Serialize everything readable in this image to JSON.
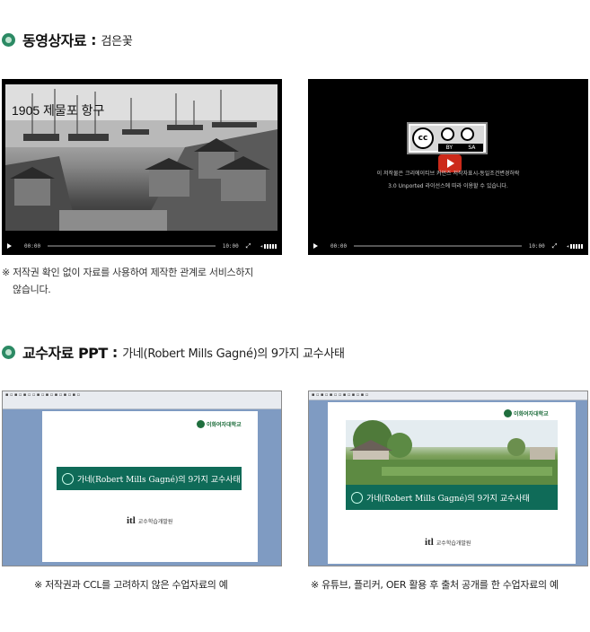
{
  "section1": {
    "title": "동영상자료",
    "colon": ":",
    "subtitle": "검은꽃"
  },
  "video1": {
    "caption": "1905 제물포 항구",
    "time_current": "00:00",
    "time_total": "10:00"
  },
  "video2": {
    "cc_by": "BY",
    "cc_sa": "SA",
    "license_line1": "이 저작물은 크리에이티브 커먼즈 저작자표시-동일조건변경허락",
    "license_line2": "3.0 Unported 라이선스에 따라 이용할 수 있습니다.",
    "time_current": "00:00",
    "time_total": "10:00"
  },
  "note1": {
    "line1": "※ 저작권 확인 없이 자료를 사용하여 제작한 관계로 서비스하지",
    "line2": "않습니다."
  },
  "section2": {
    "title": "교수자료 PPT",
    "colon": ":",
    "subtitle": "가네(Robert Mills Gagné)의 9가지 교수사태"
  },
  "slides": {
    "banner": "가네(Robert Mills Gagné)의 9가지 교수사태",
    "ewha_logo": "이화여자대학교",
    "itl_mark": "itl",
    "itl_name": "교수학습개발원"
  },
  "captions": {
    "left": "※ 저작권과 CCL를 고려하지 않은 수업자료의 예",
    "right": "※ 유튜브, 플리커, OER 활용 후 출처 공개를 한 수업자료의 예"
  },
  "colors": {
    "bullet": "#2c8a64",
    "banner": "#0f6b58",
    "ppt_frame": "#7f9bc2"
  }
}
